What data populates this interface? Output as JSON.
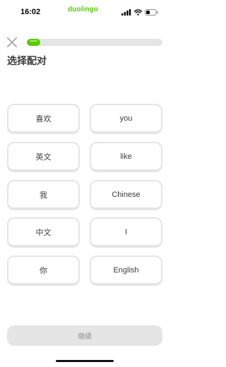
{
  "status_bar": {
    "time": "16:02",
    "brand": "duolingo"
  },
  "header": {
    "progress_fraction": 0.1
  },
  "instruction": "选择配对",
  "left_tiles": [
    {
      "label": "喜欢"
    },
    {
      "label": "英文"
    },
    {
      "label": "我"
    },
    {
      "label": "中文"
    },
    {
      "label": "你"
    }
  ],
  "right_tiles": [
    {
      "label": "you"
    },
    {
      "label": "like"
    },
    {
      "label": "Chinese"
    },
    {
      "label": "I"
    },
    {
      "label": "English"
    }
  ],
  "footer": {
    "continue_label": "继续"
  },
  "colors": {
    "accent": "#58cc02",
    "tile_border": "#e5e5e5",
    "disabled_bg": "#e5e5e5",
    "disabled_text": "#afafaf"
  },
  "icons": [
    "signal-icon",
    "wifi-icon",
    "battery-icon",
    "close-icon"
  ]
}
